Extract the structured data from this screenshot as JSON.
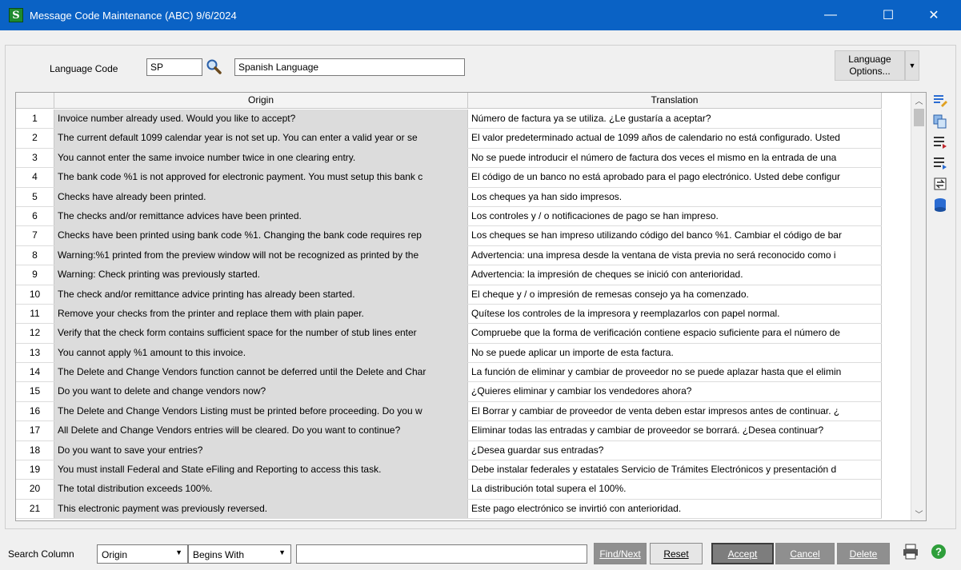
{
  "window": {
    "title": "Message Code Maintenance (ABC) 9/6/2024",
    "app_icon_letter": "S",
    "minimize": "—",
    "maximize": "☐",
    "close": "✕"
  },
  "language": {
    "label": "Language Code",
    "code": "SP",
    "description": "Spanish Language",
    "options_line1": "Language",
    "options_line2": "Options..."
  },
  "grid": {
    "headers": {
      "origin": "Origin",
      "translation": "Translation"
    },
    "rows": [
      {
        "num": "1",
        "origin": "Invoice number already used.  Would you like to accept?",
        "translation": "Número de factura ya se utiliza. ¿Le gustaría a aceptar?"
      },
      {
        "num": "2",
        "origin": "The current default 1099 calendar year is not set up.  You can enter a valid year or se",
        "translation": "El valor predeterminado actual de 1099 años de calendario no está configurado. Usted"
      },
      {
        "num": "3",
        "origin": "You cannot enter the same invoice number twice in one clearing entry.",
        "translation": "No se puede introducir el número de factura dos veces el mismo en la entrada de una"
      },
      {
        "num": "4",
        "origin": "The bank code %1 is not approved for electronic payment. You must setup this bank c",
        "translation": "El código de un banco no está aprobado para el pago electrónico. Usted debe configur"
      },
      {
        "num": "5",
        "origin": "Checks have already been printed.",
        "translation": "Los cheques ya han sido impresos."
      },
      {
        "num": "6",
        "origin": "The checks and/or remittance advices have been printed.",
        "translation": "Los controles y / o notificaciones de pago se han impreso."
      },
      {
        "num": "7",
        "origin": "Checks have been printed using bank code %1.  Changing the bank code requires rep",
        "translation": "Los cheques se han impreso utilizando código del banco %1. Cambiar el código de bar"
      },
      {
        "num": "8",
        "origin": "Warning:%1 printed from the preview window will not be recognized as printed by the",
        "translation": "Advertencia: una impresa desde la ventana de vista previa no será reconocido como i"
      },
      {
        "num": "9",
        "origin": "Warning:  Check printing was previously started.",
        "translation": "Advertencia: la impresión de cheques se inició con anterioridad."
      },
      {
        "num": "10",
        "origin": "The check and/or remittance advice printing has already been started.",
        "translation": "El cheque y / o impresión de remesas consejo ya ha comenzado."
      },
      {
        "num": "11",
        "origin": "Remove your checks from the printer and replace them with plain paper.",
        "translation": "Quítese los controles de la impresora y reemplazarlos con papel normal."
      },
      {
        "num": "12",
        "origin": "Verify that the check form contains sufficient space for the number of stub lines enter",
        "translation": "Compruebe que la forma de verificación contiene espacio suficiente para el número de"
      },
      {
        "num": "13",
        "origin": "You cannot apply %1 amount to this invoice.",
        "translation": "No se puede aplicar un importe de esta factura."
      },
      {
        "num": "14",
        "origin": "The Delete and Change Vendors function cannot be deferred until the Delete and Char",
        "translation": "La función de eliminar y cambiar de proveedor no se puede aplazar hasta que el elimin"
      },
      {
        "num": "15",
        "origin": "Do you want to delete and change vendors now?",
        "translation": "¿Quieres eliminar y cambiar los vendedores ahora?"
      },
      {
        "num": "16",
        "origin": "The Delete and Change Vendors Listing must be printed before proceeding.  Do you w",
        "translation": "El Borrar y cambiar de proveedor de venta deben estar impresos antes de continuar. ¿"
      },
      {
        "num": "17",
        "origin": "All Delete and Change Vendors entries will be cleared.  Do you want to continue?",
        "translation": "Eliminar todas las entradas y cambiar de proveedor se borrará. ¿Desea continuar?"
      },
      {
        "num": "18",
        "origin": "Do you want to save your entries?",
        "translation": "¿Desea guardar sus entradas?"
      },
      {
        "num": "19",
        "origin": "You must install Federal and State eFiling and Reporting to access this task.",
        "translation": "Debe instalar federales y estatales Servicio de Trámites Electrónicos y presentación d"
      },
      {
        "num": "20",
        "origin": "The total distribution exceeds 100%.",
        "translation": "La distribución total supera el 100%."
      },
      {
        "num": "21",
        "origin": "This electronic payment was previously reversed.",
        "translation": "Este pago electrónico se invirtió con anterioridad."
      }
    ]
  },
  "search": {
    "label": "Search Column",
    "column": "Origin",
    "mode": "Begins With",
    "value": ""
  },
  "buttons": {
    "find_next": "Find/Next",
    "reset": "Reset",
    "accept": "Accept",
    "cancel": "Cancel",
    "delete": "Delete"
  },
  "colors": {
    "titlebar": "#0a62c5",
    "origin_column_bg": "#dcdcdc",
    "help_icon": "#2e9e3a"
  }
}
